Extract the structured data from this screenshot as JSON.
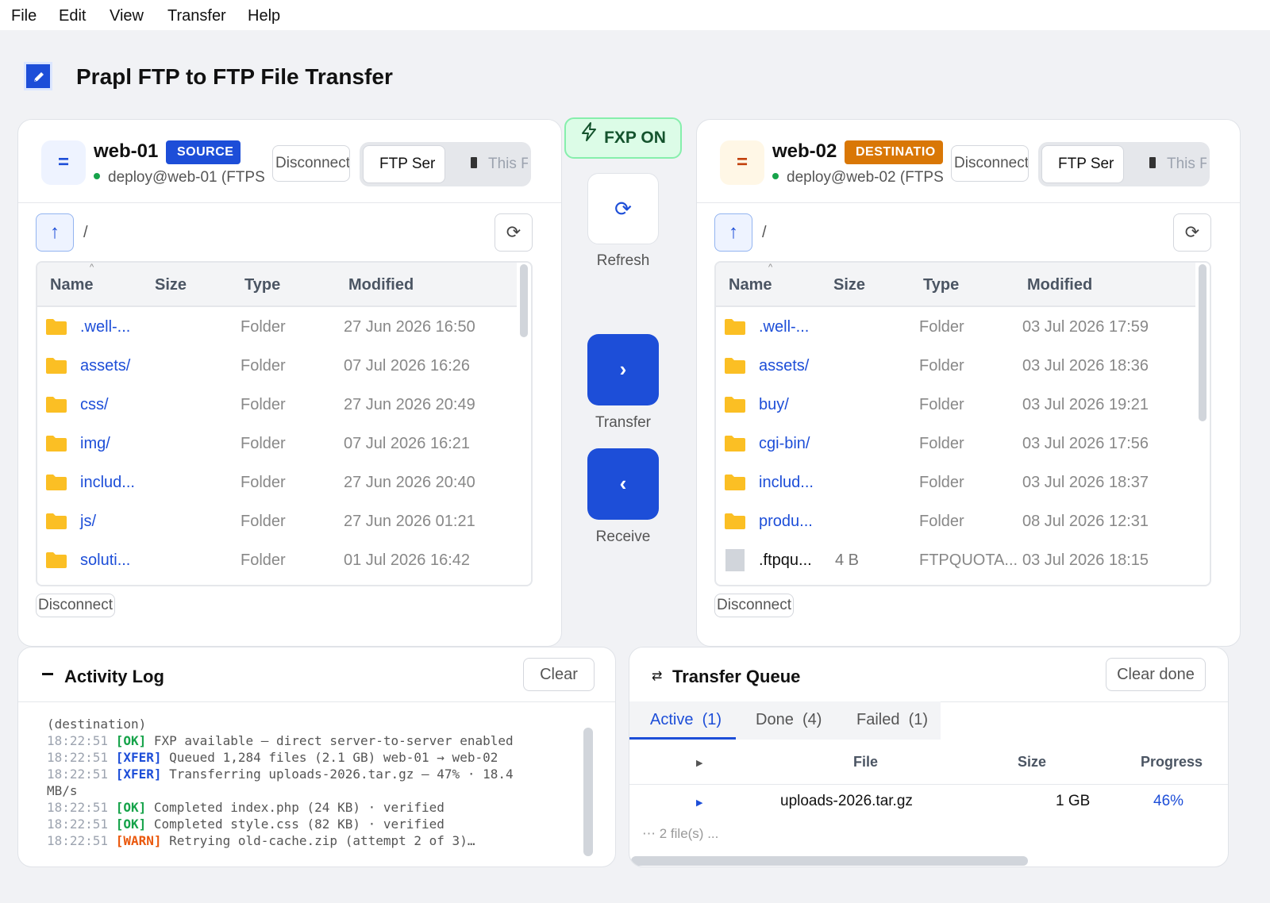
{
  "menu": [
    "File",
    "Edit",
    "View",
    "Transfer",
    "Help"
  ],
  "app": {
    "title": "Prapl FTP to FTP File Transfer"
  },
  "source": {
    "icon_glyph": "=",
    "name": "web-01",
    "badge": "SOURCE",
    "connection": "deploy@web-01 (FTPS",
    "disconnect_label": "Disconnect",
    "mode_active": "FTP Ser",
    "mode_inactive": "This F",
    "path": "/",
    "columns": [
      "Name",
      "Size",
      "Type",
      "Modified"
    ],
    "rows": [
      {
        "name": ".well-...",
        "size": "",
        "type": "Folder",
        "modified": "27 Jun 2026  16:50",
        "kind": "folder"
      },
      {
        "name": "assets/",
        "size": "",
        "type": "Folder",
        "modified": "07 Jul 2026  16:26",
        "kind": "folder"
      },
      {
        "name": "css/",
        "size": "",
        "type": "Folder",
        "modified": "27 Jun 2026  20:49",
        "kind": "folder"
      },
      {
        "name": "img/",
        "size": "",
        "type": "Folder",
        "modified": "07 Jul 2026  16:21",
        "kind": "folder"
      },
      {
        "name": "includ...",
        "size": "",
        "type": "Folder",
        "modified": "27 Jun 2026  20:40",
        "kind": "folder"
      },
      {
        "name": "js/",
        "size": "",
        "type": "Folder",
        "modified": "27 Jun 2026  01:21",
        "kind": "folder"
      },
      {
        "name": "soluti...",
        "size": "",
        "type": "Folder",
        "modified": "01 Jul 2026  16:42",
        "kind": "folder"
      }
    ],
    "bottom_disconnect": "Disconnect"
  },
  "destination": {
    "icon_glyph": "=",
    "name": "web-02",
    "badge": "DESTINATIO",
    "connection": "deploy@web-02 (FTPS",
    "disconnect_label": "Disconnect",
    "mode_active": "FTP Ser",
    "mode_inactive": "This F",
    "path": "/",
    "columns": [
      "Name",
      "Size",
      "Type",
      "Modified"
    ],
    "rows": [
      {
        "name": ".well-...",
        "size": "",
        "type": "Folder",
        "modified": "03 Jul 2026  17:59",
        "kind": "folder"
      },
      {
        "name": "assets/",
        "size": "",
        "type": "Folder",
        "modified": "03 Jul 2026  18:36",
        "kind": "folder"
      },
      {
        "name": "buy/",
        "size": "",
        "type": "Folder",
        "modified": "03 Jul 2026  19:21",
        "kind": "folder"
      },
      {
        "name": "cgi-bin/",
        "size": "",
        "type": "Folder",
        "modified": "03 Jul 2026  17:56",
        "kind": "folder"
      },
      {
        "name": "includ...",
        "size": "",
        "type": "Folder",
        "modified": "03 Jul 2026  18:37",
        "kind": "folder"
      },
      {
        "name": "produ...",
        "size": "",
        "type": "Folder",
        "modified": "08 Jul 2026  12:31",
        "kind": "folder"
      },
      {
        "name": ".ftpqu...",
        "size": "4 B",
        "type": "FTPQUOTA...",
        "modified": "03 Jul 2026  18:15",
        "kind": "file"
      }
    ],
    "bottom_disconnect": "Disconnect"
  },
  "center": {
    "fxp_label": "FXP ON",
    "refresh_label": "Refresh",
    "transfer_glyph": "›",
    "transfer_label": "Transfer",
    "receive_glyph": "‹",
    "receive_label": "Receive"
  },
  "activity_log": {
    "title": "Activity Log",
    "clear_label": "Clear",
    "lines": [
      {
        "ts": "",
        "tag": "",
        "level": "",
        "text": "(destination)"
      },
      {
        "ts": "18:22:51",
        "tag": "[OK]",
        "level": "ok",
        "text": "FXP available — direct server-to-server enabled"
      },
      {
        "ts": "18:22:51",
        "tag": "[XFER]",
        "level": "xfer",
        "text": "Queued 1,284 files (2.1 GB) web-01 → web-02"
      },
      {
        "ts": "18:22:51",
        "tag": "[XFER]",
        "level": "xfer",
        "text": "Transferring uploads-2026.tar.gz — 47% · 18.4"
      },
      {
        "ts": "",
        "tag": "",
        "level": "",
        "text": "MB/s"
      },
      {
        "ts": "18:22:51",
        "tag": "[OK]",
        "level": "ok",
        "text": "Completed index.php (24 KB) · verified"
      },
      {
        "ts": "18:22:51",
        "tag": "[OK]",
        "level": "ok",
        "text": "Completed style.css (82 KB) · verified"
      },
      {
        "ts": "18:22:51",
        "tag": "[WARN]",
        "level": "warn",
        "text": "Retrying old-cache.zip (attempt 2 of 3)…"
      }
    ]
  },
  "transfer_queue": {
    "title": "Transfer Queue",
    "clear_done_label": "Clear done",
    "tabs": [
      {
        "label": "Active",
        "count": "(1)"
      },
      {
        "label": "Done",
        "count": "(4)"
      },
      {
        "label": "Failed",
        "count": "(1)"
      }
    ],
    "columns": [
      "File",
      "Size",
      "Progress"
    ],
    "rows": [
      {
        "file": "uploads-2026.tar.gz",
        "size": "1 GB",
        "progress": "46%"
      }
    ],
    "more": "2 file(s) ..."
  },
  "colors": {
    "accent": "#1d4ed8",
    "source_badge": "#1d4ed8",
    "destination_badge": "#d97706",
    "fxp_bg": "#dcfce7",
    "ok": "#16a34a",
    "warn": "#ea580c",
    "folder": "#fbbf24"
  },
  "icons": {
    "app": "pencil-icon",
    "fxp": "lightning-bolt-icon",
    "refresh": "refresh-icon",
    "up": "arrow-up-icon",
    "folder": "folder-icon",
    "file": "file-icon",
    "log": "log-icon",
    "queue": "swap-arrows-icon"
  }
}
